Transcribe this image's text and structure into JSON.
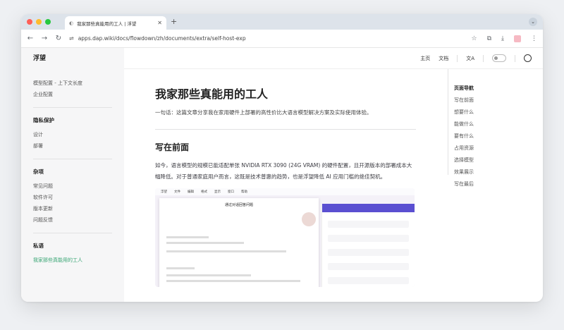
{
  "browser": {
    "tab_title": "我家那些真能用的工人 | 浮望",
    "url": "apps.dap.wiki/docs/flowdown/zh/documents/extra/self-host-exp"
  },
  "site": {
    "brand": "浮望",
    "nav": {
      "home": "主页",
      "docs": "文档",
      "lang": "文A"
    }
  },
  "sidebar": {
    "top_items": [
      "模型配置 - 上下文长度",
      "企业配置"
    ],
    "sections": [
      {
        "title": "隐私保护",
        "items": [
          "设计",
          "部署"
        ]
      },
      {
        "title": "杂项",
        "items": [
          "常见问题",
          "软件许可",
          "版本更新",
          "问题反馈"
        ]
      },
      {
        "title": "私语",
        "items": [
          "我家那些真能用的工人"
        ]
      }
    ]
  },
  "article": {
    "title": "我家那些真能用的工人",
    "lead": "一句话：这篇文章分享我在家用硬件上部署的高性价比大语言模型解决方案及实际使用体验。",
    "h2": "写在前面",
    "paragraph": "如今，语言模型的规模已能适配单张 NVIDIA RTX 3090 (24G VRAM) 的硬件配置，且开源版本的部署成本大幅降低。对于普通家庭用户而言，这既是技术普惠的趋势，也是浮望降低 AI 应用门槛的绝佳契机。",
    "screenshot": {
      "menu": [
        "浮望",
        "文件",
        "编辑",
        "格式",
        "显示",
        "窗口",
        "帮助"
      ],
      "dialog_title": "通过对话回答问题"
    }
  },
  "outline": {
    "title": "页面导航",
    "items": [
      "写在前面",
      "想要什么",
      "能做什么",
      "要有什么",
      "占用资源",
      "选择模型",
      "效果展示",
      "写在最后"
    ]
  },
  "colors": {
    "accent": "#3aa675",
    "panel": "#5a4fd1"
  }
}
